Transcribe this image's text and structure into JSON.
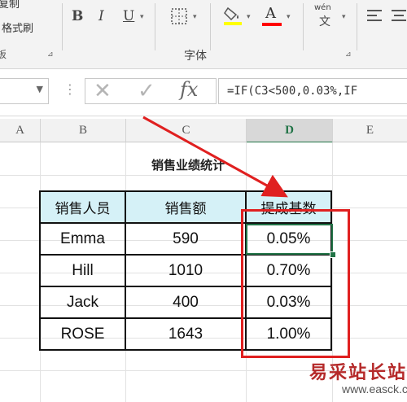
{
  "ribbon": {
    "clipboard_partial": "复制",
    "format_painter": "格式刷",
    "clipboard_group_partial": "板",
    "bold": "B",
    "italic": "I",
    "underline": "U",
    "font_color_letter": "A",
    "phonetic_top": "wén",
    "phonetic_bottom": "文",
    "font_group": "字体",
    "highlight_color": "#ffff00",
    "font_color": "#ff0000"
  },
  "formula_bar": {
    "namebox_value": "",
    "fx_label": "fx",
    "cancel_label": "✕",
    "enter_label": "✓",
    "formula": "=IF(C3<500,0.03%,IF"
  },
  "columns": [
    "A",
    "B",
    "C",
    "D",
    "E"
  ],
  "sheet": {
    "title": "销售业绩统计",
    "headers": [
      "销售人员",
      "销售额",
      "提成基数"
    ],
    "rows": [
      {
        "name": "Emma",
        "sales": "590",
        "rate": "0.05%"
      },
      {
        "name": "Hill",
        "sales": "1010",
        "rate": "0.70%"
      },
      {
        "name": "Jack",
        "sales": "400",
        "rate": "0.03%"
      },
      {
        "name": "ROSE",
        "sales": "1643",
        "rate": "1.00%"
      }
    ]
  },
  "watermark": {
    "text": "易采站长站",
    "url": "www.easck.com"
  }
}
